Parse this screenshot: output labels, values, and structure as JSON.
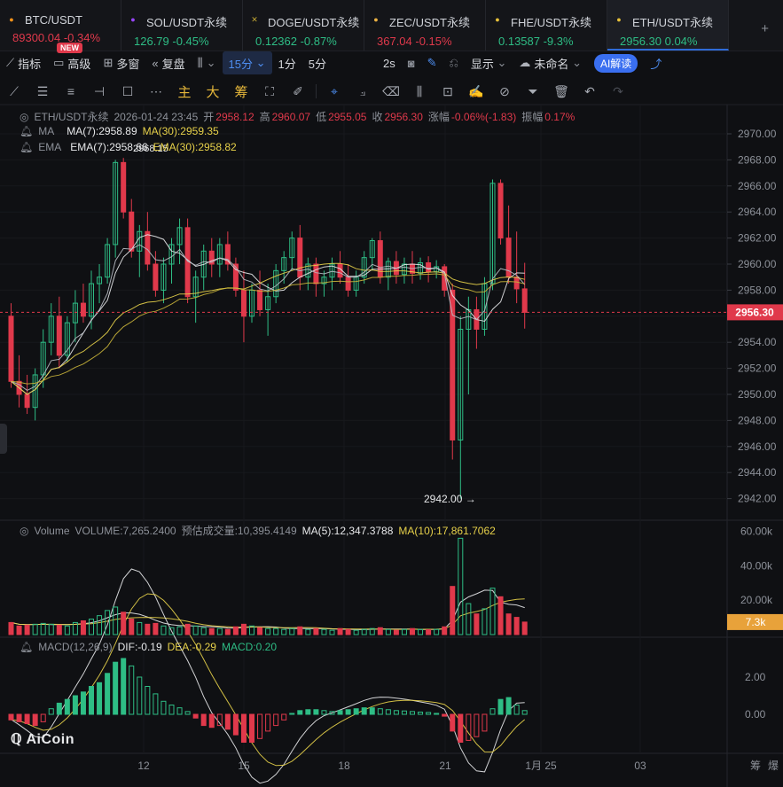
{
  "tickers": [
    {
      "name": "BTC/USDT",
      "price": "89300.04",
      "change": "-0.34%",
      "dir": "dn",
      "icon": "btc-icon"
    },
    {
      "name": "SOL/USDT永续",
      "price": "126.79",
      "change": "-0.45%",
      "dir": "up",
      "icon": "sol-icon"
    },
    {
      "name": "DOGE/USDT永续",
      "price": "0.12362",
      "change": "-0.87%",
      "dir": "up",
      "icon": "doge-icon"
    },
    {
      "name": "ZEC/USDT永续",
      "price": "367.04",
      "change": "-0.15%",
      "dir": "dn",
      "icon": "zec-icon"
    },
    {
      "name": "FHE/USDT永续",
      "price": "0.13587",
      "change": "-9.3%",
      "dir": "up",
      "icon": "fhe-icon"
    },
    {
      "name": "ETH/USDT永续",
      "price": "2956.30",
      "change": "0.04%",
      "dir": "up",
      "icon": "eth-icon"
    }
  ],
  "new_badge": "NEW",
  "add_tab": "+",
  "toolbar": {
    "indicators": "指标",
    "advanced": "高级",
    "multi_window": "多窗",
    "replay": "复盘",
    "interval": "15分",
    "int_1m": "1分",
    "int_5m": "5分",
    "refresh": "2s",
    "display": "显示",
    "layout_name": "未命名",
    "ai": "AI解读"
  },
  "drawbar": {
    "main": "主",
    "big": "大",
    "chips": "筹"
  },
  "main_legend": {
    "symbol": "ETH/USDT永续",
    "datetime": "2026-01-24 23:45",
    "open_label": "开",
    "open": "2958.12",
    "high_label": "高",
    "high": "2960.07",
    "low_label": "低",
    "low": "2955.05",
    "close_label": "收",
    "close": "2956.30",
    "chg_label": "涨幅",
    "chg": "-0.06%(-1.83)",
    "amp_label": "振幅",
    "amp": "0.17%",
    "ma_name": "MA",
    "ma7": "MA(7):2958.89",
    "ma30": "MA(30):2959.35",
    "ema_name": "EMA",
    "ema7": "EMA(7):2958.66",
    "ema30": "EMA(30):2958.82"
  },
  "vol_legend": {
    "name": "Volume",
    "vol": "VOLUME:7,265.2400",
    "est": "预估成交量:10,395.4149",
    "ma5": "MA(5):12,347.3788",
    "ma10": "MA(10):17,861.7062"
  },
  "macd_legend": {
    "name": "MACD(12,26,9)",
    "dif": "DIF:-0.19",
    "dea": "DEA:-0.29",
    "macd": "MACD:0.20"
  },
  "price_axis": [
    "2970.00",
    "2968.00",
    "2966.00",
    "2964.00",
    "2962.00",
    "2960.00",
    "2958.00",
    "2956.00",
    "2954.00",
    "2952.00",
    "2950.00",
    "2948.00",
    "2946.00",
    "2944.00",
    "2942.00"
  ],
  "current_price": "2956.30",
  "high_marker": "2968.15",
  "low_marker": "2942.00",
  "vol_axis": [
    "60.00k",
    "40.00k",
    "20.00k"
  ],
  "current_vol": "7.3k",
  "macd_axis": [
    "2.00",
    "0.00"
  ],
  "time_axis": [
    "12",
    "15",
    "18",
    "21",
    "1月 25",
    "03"
  ],
  "corner_labels": [
    "筹",
    "爆"
  ],
  "watermark": "AiCoin",
  "colors": {
    "up": "#2ebd85",
    "down": "#e0394b",
    "ma7": "#e7e8ea",
    "ma30": "#e7d14a"
  },
  "chart_data": {
    "type": "candlestick",
    "interval": "15m",
    "ylim": [
      2942,
      2970
    ],
    "note_close": 2956.3,
    "candles": [
      [
        2956,
        2957,
        2950.5,
        2951
      ],
      [
        2951,
        2953,
        2949,
        2950
      ],
      [
        2950,
        2951.5,
        2948.5,
        2949
      ],
      [
        2949,
        2952,
        2948,
        2951.5
      ],
      [
        2951.5,
        2955,
        2950.5,
        2954
      ],
      [
        2954,
        2957,
        2953,
        2956
      ],
      [
        2956,
        2957.5,
        2952,
        2953
      ],
      [
        2953,
        2956,
        2952.5,
        2955.5
      ],
      [
        2955.5,
        2958,
        2954,
        2957
      ],
      [
        2957,
        2958.5,
        2955.5,
        2956
      ],
      [
        2956,
        2959.5,
        2955,
        2958.5
      ],
      [
        2958.5,
        2960,
        2957,
        2959
      ],
      [
        2959,
        2962,
        2958.5,
        2961.5
      ],
      [
        2961.5,
        2968,
        2960.5,
        2967.8
      ],
      [
        2967.8,
        2968.15,
        2963.5,
        2964
      ],
      [
        2964,
        2965,
        2960.5,
        2961
      ],
      [
        2961,
        2963,
        2959,
        2962.5
      ],
      [
        2962.5,
        2964,
        2959.5,
        2960
      ],
      [
        2960,
        2961,
        2957.5,
        2958
      ],
      [
        2958,
        2960.5,
        2957,
        2960
      ],
      [
        2960,
        2962,
        2958.5,
        2961.5
      ],
      [
        2961.5,
        2963.5,
        2960,
        2962.8
      ],
      [
        2962.8,
        2963.5,
        2957,
        2957.5
      ],
      [
        2957.5,
        2959.5,
        2955.5,
        2959
      ],
      [
        2959,
        2961.5,
        2958,
        2961
      ],
      [
        2961,
        2962,
        2959,
        2960
      ],
      [
        2960,
        2962,
        2959,
        2961.5
      ],
      [
        2961.5,
        2962.5,
        2959.5,
        2960
      ],
      [
        2960,
        2960.5,
        2957.5,
        2958
      ],
      [
        2958,
        2959.5,
        2954,
        2956
      ],
      [
        2956,
        2958.5,
        2955.5,
        2958
      ],
      [
        2958,
        2959.5,
        2956,
        2956.5
      ],
      [
        2956.5,
        2958.5,
        2954.5,
        2957.5
      ],
      [
        2957.5,
        2960,
        2957,
        2959.5
      ],
      [
        2959.5,
        2961,
        2958.5,
        2960.5
      ],
      [
        2960.5,
        2962.5,
        2959.5,
        2962
      ],
      [
        2962,
        2963,
        2958,
        2959
      ],
      [
        2959,
        2960.5,
        2958,
        2960
      ],
      [
        2960,
        2960.5,
        2957.5,
        2958.5
      ],
      [
        2958.5,
        2959.5,
        2957.5,
        2959
      ],
      [
        2959,
        2960.5,
        2958,
        2960
      ],
      [
        2960,
        2961,
        2958.5,
        2959
      ],
      [
        2959,
        2960,
        2957.5,
        2958
      ],
      [
        2958,
        2959.5,
        2957.5,
        2959
      ],
      [
        2959,
        2961,
        2958.5,
        2960.5
      ],
      [
        2960.5,
        2962,
        2959.5,
        2961.8
      ],
      [
        2961.8,
        2962.5,
        2958.5,
        2959
      ],
      [
        2959,
        2960.5,
        2958,
        2960.2
      ],
      [
        2960.2,
        2961,
        2958.5,
        2959.2
      ],
      [
        2959.2,
        2960.5,
        2958.5,
        2960
      ],
      [
        2960,
        2961,
        2958.5,
        2959.3
      ],
      [
        2959.3,
        2960.5,
        2958.8,
        2960.1
      ],
      [
        2960.1,
        2960.6,
        2958.6,
        2959.4
      ],
      [
        2959.4,
        2960.3,
        2958.9,
        2959.8
      ],
      [
        2959.8,
        2960,
        2957.5,
        2958
      ],
      [
        2958,
        2958.5,
        2945,
        2946.5
      ],
      [
        2946.5,
        2956,
        2942,
        2955
      ],
      [
        2955,
        2957.5,
        2950,
        2956.5
      ],
      [
        2956.5,
        2957.5,
        2953.5,
        2955
      ],
      [
        2955,
        2959,
        2954.5,
        2958.5
      ],
      [
        2958.5,
        2966.5,
        2958,
        2966.2
      ],
      [
        2966.2,
        2966.5,
        2961.5,
        2962
      ],
      [
        2962,
        2964.5,
        2958.5,
        2959
      ],
      [
        2959,
        2962.5,
        2957,
        2958.1
      ],
      [
        2958.1,
        2960.1,
        2955.05,
        2956.3
      ]
    ],
    "volume": [
      7000,
      5000,
      5500,
      6000,
      6500,
      6000,
      5500,
      5000,
      7000,
      8000,
      9000,
      11000,
      14000,
      16000,
      13000,
      9000,
      7000,
      6000,
      6500,
      5000,
      4000,
      4500,
      6000,
      5000,
      4000,
      3500,
      3500,
      3000,
      4500,
      6000,
      5000,
      4000,
      3500,
      3500,
      3000,
      3500,
      4500,
      3000,
      3500,
      3000,
      2500,
      3500,
      3000,
      2500,
      3000,
      3500,
      4000,
      3000,
      2500,
      3000,
      3500,
      3000,
      2800,
      3000,
      4500,
      28000,
      56000,
      18000,
      12000,
      15000,
      27000,
      22000,
      12000,
      10000,
      7265
    ],
    "macd_hist": [
      -0.3,
      -0.4,
      -0.5,
      -0.6,
      -0.4,
      0.3,
      0.6,
      0.8,
      1.0,
      1.2,
      1.5,
      1.7,
      2.2,
      2.8,
      3.0,
      2.6,
      2.0,
      1.5,
      1.1,
      0.7,
      0.5,
      0.35,
      0.15,
      -0.2,
      -0.6,
      -0.7,
      -0.6,
      -0.8,
      -1.1,
      -1.5,
      -1.5,
      -1.3,
      -0.9,
      -0.6,
      -0.3,
      0.05,
      0.2,
      0.25,
      0.25,
      0.2,
      0.15,
      0.2,
      0.25,
      0.3,
      0.35,
      0.35,
      0.3,
      0.25,
      0.2,
      0.18,
      0.15,
      0.12,
      0.1,
      0.05,
      -0.1,
      -0.9,
      -1.5,
      -1.4,
      -1.2,
      -0.9,
      0.3,
      0.8,
      0.9,
      0.5,
      0.2
    ]
  }
}
